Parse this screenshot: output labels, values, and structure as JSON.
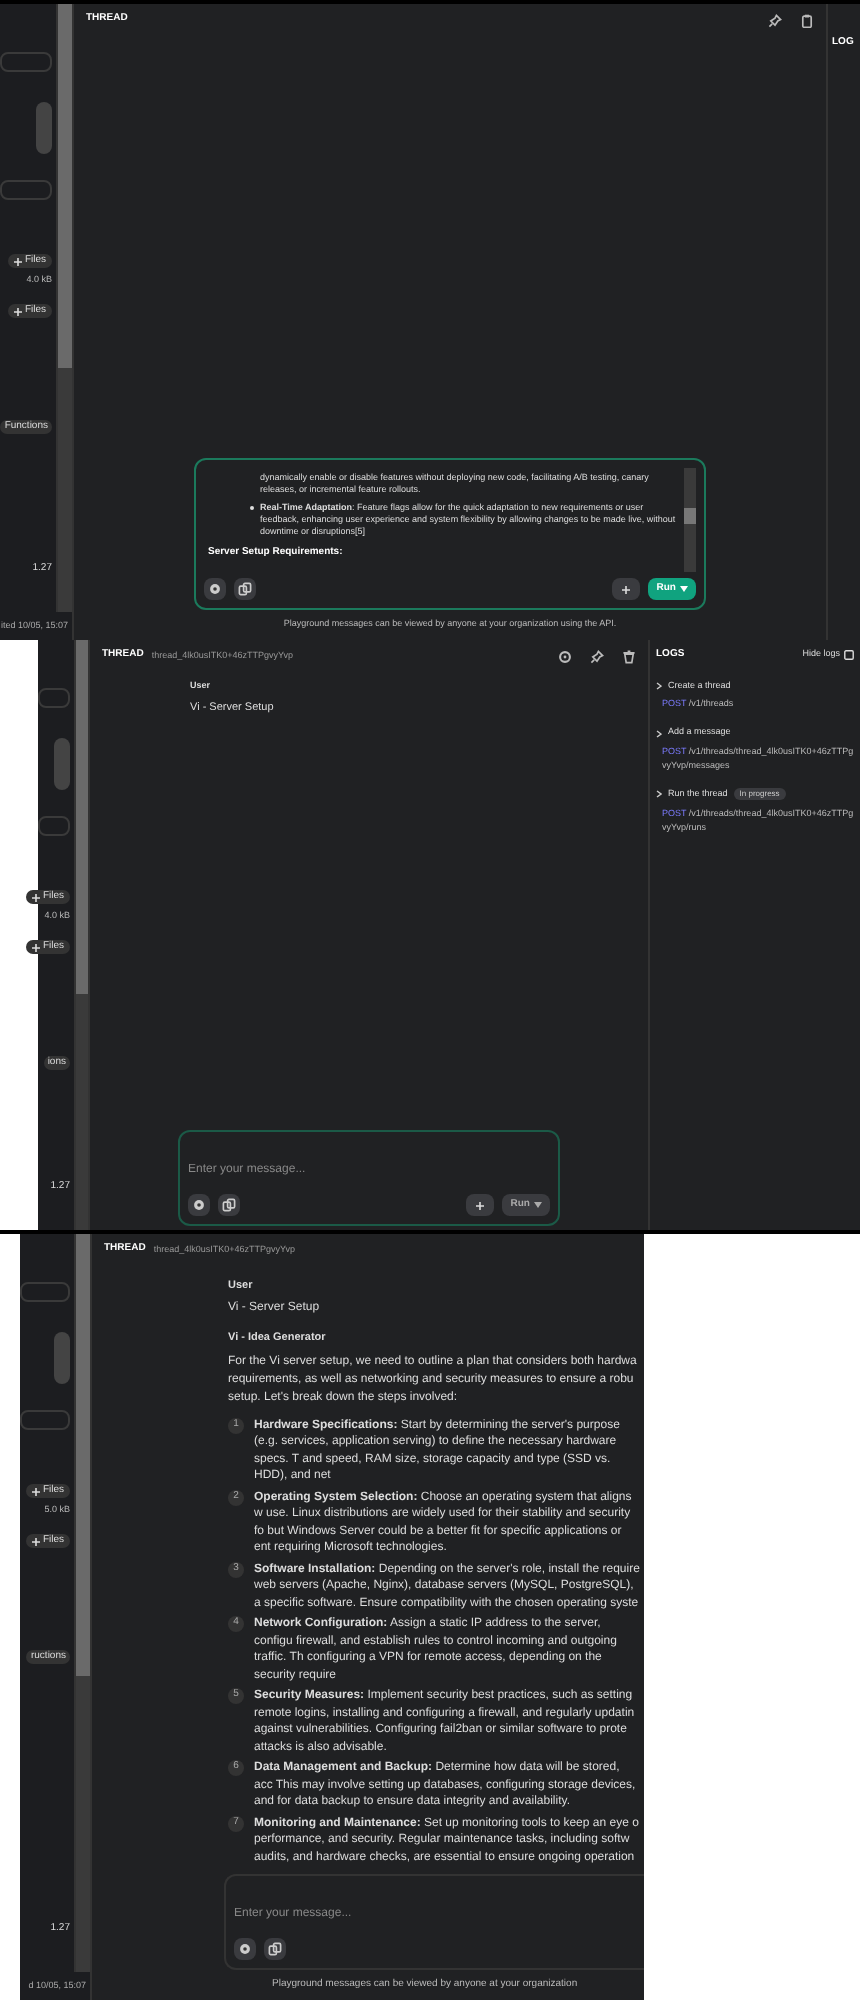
{
  "screen_1": {
    "sidebar": [
      {
        "kind": "files_button",
        "label": "Files"
      },
      {
        "kind": "size",
        "label": "4.0 kB"
      },
      {
        "kind": "files_button",
        "label": "Files"
      },
      {
        "kind": "functions_button",
        "label": "Functions"
      },
      {
        "kind": "value",
        "label": "1.27"
      }
    ],
    "sidebar_footer": "ited 10/05, 15:07",
    "header": {
      "title": "THREAD"
    },
    "logs_title": "LOG",
    "composer": {
      "lines": [
        {
          "kind": "text",
          "text": "dynamically enable or disable features without deploying new code, facilitating A/B testing, canary releases, or incremental feature rollouts."
        },
        {
          "kind": "bullet",
          "text": "**Real-Time Adaptation**: Feature flags allow for the quick adaptation to new requirements or user feedback, enhancing user experience and system flexibility by allowing changes to be made live, without downtime or disruptions[5]"
        },
        {
          "kind": "heading",
          "text": "Server Setup Requirements:"
        }
      ],
      "run": "Run",
      "run_enabled": true
    },
    "footer": "Playground messages can be viewed by anyone at your organization using the API."
  },
  "screen_2": {
    "sidebar": [
      {
        "kind": "files_button",
        "label": "Files"
      },
      {
        "kind": "size",
        "label": "4.0 kB"
      },
      {
        "kind": "files_button",
        "label": "Files"
      },
      {
        "kind": "functions_button",
        "label": "ions"
      },
      {
        "kind": "value",
        "label": "1.27"
      }
    ],
    "header": {
      "title": "THREAD",
      "thread_id": "thread_4lk0usITK0+46zTTPgvyYvp"
    },
    "messages": [
      {
        "role": "User",
        "text": "Vi - Server Setup"
      }
    ],
    "composer": {
      "placeholder": "Enter your message...",
      "run": "Run",
      "run_enabled": false
    },
    "logs": {
      "title": "LOGS",
      "hide": "Hide logs",
      "entries": [
        {
          "title": "Create a thread",
          "method": "POST",
          "path": "/v1/threads"
        },
        {
          "title": "Add a message",
          "method": "POST",
          "path": "/v1/threads/thread_4lk0usITK0+46zTTPgvyYvp/messages"
        },
        {
          "title": "Run the thread",
          "badge": "In progress",
          "method": "POST",
          "path": "/v1/threads/thread_4lk0usITK0+46zTTPgvyYvp/runs"
        }
      ]
    }
  },
  "screen_3": {
    "sidebar": [
      {
        "kind": "files_button",
        "label": "Files"
      },
      {
        "kind": "size",
        "label": "5.0 kB"
      },
      {
        "kind": "files_button",
        "label": "Files"
      },
      {
        "kind": "functions_button",
        "label": "ructions"
      },
      {
        "kind": "value",
        "label": "1.27"
      }
    ],
    "sidebar_footer": "d 10/05, 15:07",
    "header": {
      "title": "THREAD",
      "thread_id": "thread_4lk0usITK0+46zTTPgvyYvp"
    },
    "messages": [
      {
        "role": "User",
        "text": "Vi - Server Setup"
      },
      {
        "role": "Vi - Idea Generator",
        "text": "For the Vi server setup, we need to outline a plan that considers both hardwa requirements, as well as networking and security measures to ensure a robu setup. Let's break down the steps involved:",
        "steps": [
          {
            "number": "1",
            "text": "**Hardware Specifications:** Start by determining the server's purpose (e.g. services, application serving) to define the necessary hardware specs. T and speed, RAM size, storage capacity and type (SSD vs. HDD), and net"
          },
          {
            "number": "2",
            "text": "**Operating System Selection:** Choose an operating system that aligns w use. Linux distributions are widely used for their stability and security fo but Windows Server could be a better fit for specific applications or ent requiring Microsoft technologies."
          },
          {
            "number": "3",
            "text": "**Software Installation:** Depending on the server's role, install the require web servers (Apache, Nginx), database servers (MySQL, PostgreSQL), a specific software. Ensure compatibility with the chosen operating syste"
          },
          {
            "number": "4",
            "text": "**Network Configuration:** Assign a static IP address to the server, configu firewall, and establish rules to control incoming and outgoing traffic. Th configuring a VPN for remote access, depending on the security require"
          },
          {
            "number": "5",
            "text": "**Security Measures:** Implement security best practices, such as setting remote logins, installing and configuring a firewall, and regularly updatin against vulnerabilities. Configuring fail2ban or similar software to prote attacks is also advisable."
          },
          {
            "number": "6",
            "text": "**Data Management and Backup:** Determine how data will be stored, acc This may involve setting up databases, configuring storage devices, and for data backup to ensure data integrity and availability."
          },
          {
            "number": "7",
            "text": "**Monitoring and Maintenance:** Set up monitoring tools to keep an eye o performance, and security. Regular maintenance tasks, including softw audits, and hardware checks, are essential to ensure ongoing operation"
          }
        ]
      }
    ],
    "composer": {
      "placeholder": "Enter your message..."
    },
    "footer": "Playground messages can be viewed by anyone at your organization"
  }
}
